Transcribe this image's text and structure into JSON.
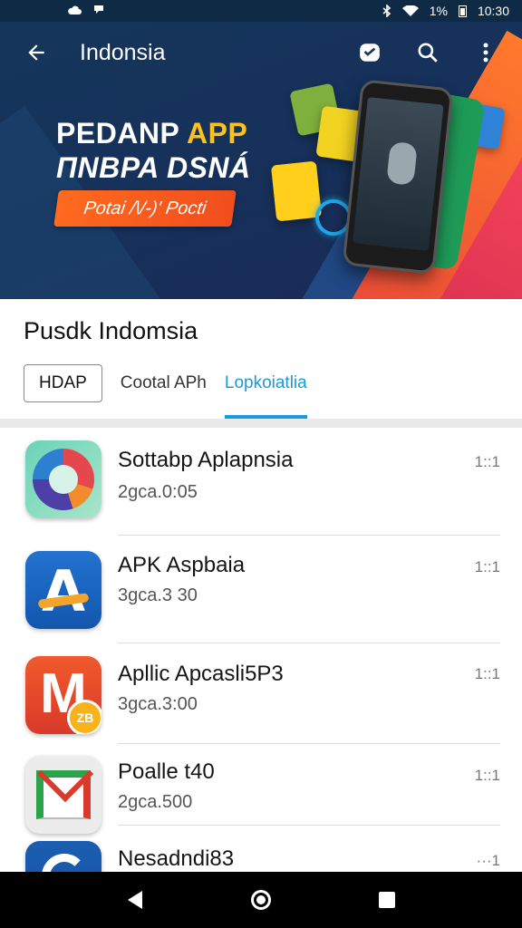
{
  "status_bar": {
    "time": "10:30",
    "battery": "1%",
    "icons": [
      "cloud-icon",
      "notification-icon",
      "bluetooth-icon",
      "wifi-icon",
      "battery-icon"
    ]
  },
  "app_bar": {
    "title": "Indonsia",
    "icons": [
      "back-arrow-icon",
      "inbox-icon",
      "search-icon",
      "more-vert-icon"
    ]
  },
  "banner": {
    "headline_part1": "PEDANP ",
    "headline_accent": "APP",
    "headline_line2": "ΠNBPA DSNÁ",
    "cta_label": "Potai /\\/-)' Pocti",
    "colors": {
      "accent": "#ffc21a",
      "cta": "#f05a1f",
      "background": "#15365a"
    }
  },
  "section": {
    "title": "Pusdk Indomsia"
  },
  "tabs": [
    {
      "label": "HDAP"
    },
    {
      "label": "Cootal APh"
    },
    {
      "label": "Lopkoiatlia"
    }
  ],
  "apps": [
    {
      "name": "Sottabp Aplapnsia",
      "meta": "2gca.0:05",
      "size": "1::1",
      "icon": "swirl-icon"
    },
    {
      "name": "APK Aspbaia",
      "meta": "3gca.3 30",
      "size": "1::1",
      "icon": "letter-a-icon"
    },
    {
      "name": "Apllic Apcasli5P3",
      "meta": "3gca.3:00",
      "size": "1::1",
      "icon": "letter-m-icon"
    },
    {
      "name": "Poalle t40",
      "meta": "2gca.500",
      "size": "1::1",
      "icon": "mail-icon"
    },
    {
      "name": "Nesadndi83",
      "meta": "",
      "size": "···1",
      "icon": "ring-icon"
    }
  ],
  "accent_color": "#1a9ad6"
}
